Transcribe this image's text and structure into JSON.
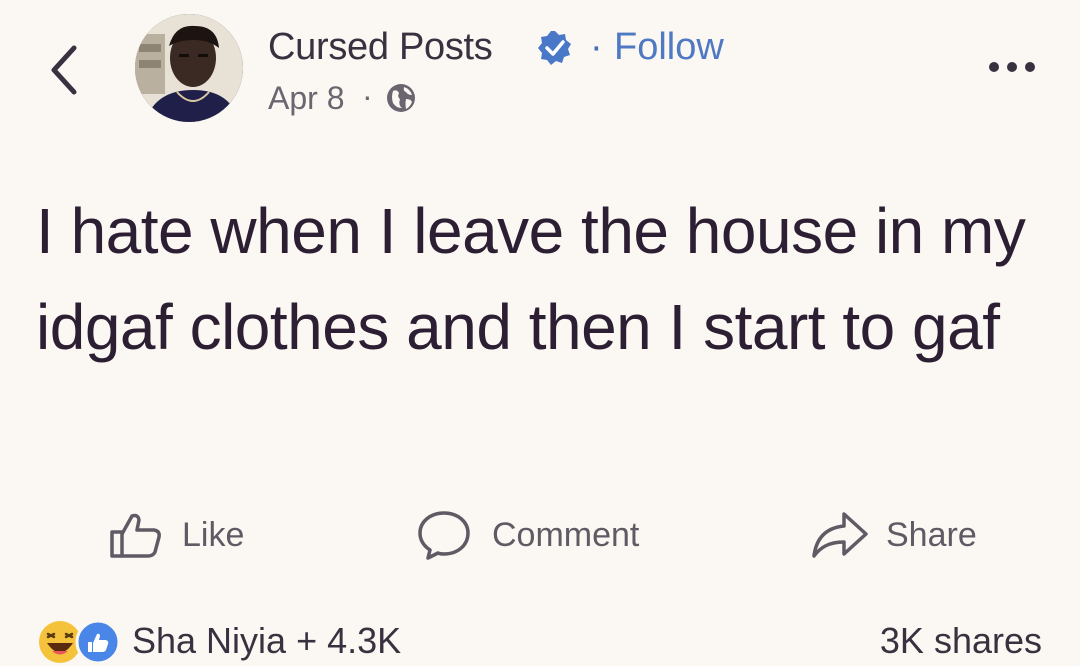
{
  "post": {
    "page_name": "Cursed Posts",
    "follow_label": "Follow",
    "date": "Apr 8",
    "text": "I hate when I leave the house in my idgaf clothes and then I start to gaf"
  },
  "actions": {
    "like_label": "Like",
    "comment_label": "Comment",
    "share_label": "Share"
  },
  "footer": {
    "reactors": "Sha Niyia + 4.3K",
    "shares": "3K shares"
  },
  "icons": {
    "back": "chevron-left-icon",
    "verified": "verified-badge-icon",
    "privacy": "globe-icon",
    "more": "more-dots-icon",
    "like": "thumbs-up-icon",
    "comment": "comment-bubble-icon",
    "share": "share-arrow-icon",
    "reaction_haha": "haha-reaction-icon",
    "reaction_like": "like-reaction-icon"
  },
  "colors": {
    "background": "#fbf7f2",
    "text": "#2d1f33",
    "link": "#4f79c2",
    "verified": "#4a78c8",
    "muted": "#6b6570"
  }
}
